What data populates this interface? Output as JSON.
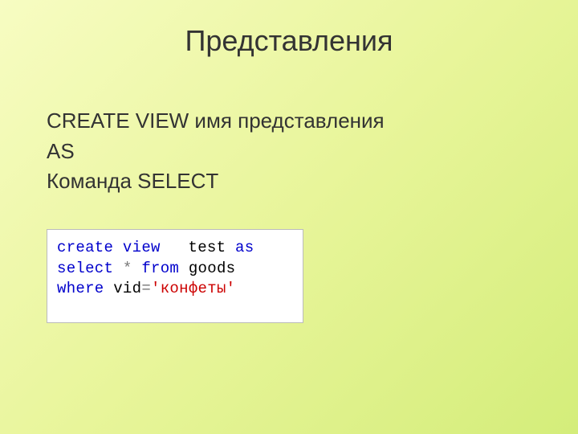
{
  "slide": {
    "title": "Представления",
    "body": {
      "line1": "CREATE VIEW имя представления",
      "line2": "AS",
      "line3": "Команда SELECT"
    },
    "code": {
      "l1_kw1": "create",
      "l1_kw2": "view",
      "l1_txt": "test",
      "l1_kw3": "as",
      "l2_kw1": "select",
      "l2_op": "*",
      "l2_kw2": "from",
      "l2_txt": "goods",
      "l3_kw": "where",
      "l3_txt": "vid",
      "l3_eq": "=",
      "l3_str": "'конфеты'"
    }
  }
}
